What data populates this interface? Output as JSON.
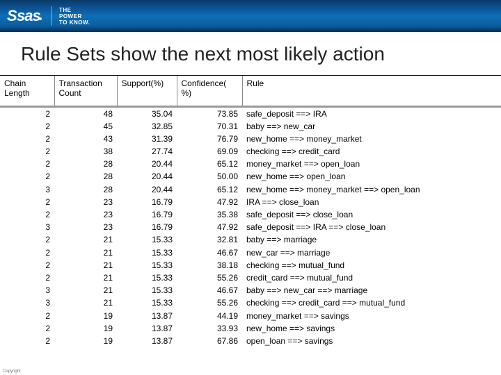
{
  "banner": {
    "brand": "SAS",
    "tagline_l1": "THE",
    "tagline_l2": "POWER",
    "tagline_l3": "TO KNOW."
  },
  "heading": "Rule Sets show the next most likely action",
  "table": {
    "columns": {
      "chain": "Chain\nLength",
      "count": "Transaction\nCount",
      "support": "Support(%)",
      "confidence": "Confidence(\n%)",
      "rule": "Rule"
    },
    "rows": [
      {
        "chain": "2",
        "count": "48",
        "support": "35.04",
        "confidence": "73.85",
        "rule": "safe_deposit ==> IRA"
      },
      {
        "chain": "2",
        "count": "45",
        "support": "32.85",
        "confidence": "70.31",
        "rule": "baby ==> new_car"
      },
      {
        "chain": "2",
        "count": "43",
        "support": "31.39",
        "confidence": "76.79",
        "rule": "new_home ==> money_market"
      },
      {
        "chain": "2",
        "count": "38",
        "support": "27.74",
        "confidence": "69.09",
        "rule": "checking ==> credit_card"
      },
      {
        "chain": "2",
        "count": "28",
        "support": "20.44",
        "confidence": "65.12",
        "rule": "money_market ==> open_loan"
      },
      {
        "chain": "2",
        "count": "28",
        "support": "20.44",
        "confidence": "50.00",
        "rule": "new_home ==> open_loan"
      },
      {
        "chain": "3",
        "count": "28",
        "support": "20.44",
        "confidence": "65.12",
        "rule": "new_home ==> money_market ==> open_loan"
      },
      {
        "chain": "2",
        "count": "23",
        "support": "16.79",
        "confidence": "47.92",
        "rule": "IRA ==> close_loan"
      },
      {
        "chain": "2",
        "count": "23",
        "support": "16.79",
        "confidence": "35.38",
        "rule": "safe_deposit ==> close_loan"
      },
      {
        "chain": "3",
        "count": "23",
        "support": "16.79",
        "confidence": "47.92",
        "rule": "safe_deposit ==> IRA ==> close_loan"
      },
      {
        "chain": "2",
        "count": "21",
        "support": "15.33",
        "confidence": "32.81",
        "rule": "baby ==> marriage"
      },
      {
        "chain": "2",
        "count": "21",
        "support": "15.33",
        "confidence": "46.67",
        "rule": "new_car ==> marriage"
      },
      {
        "chain": "2",
        "count": "21",
        "support": "15.33",
        "confidence": "38.18",
        "rule": "checking ==> mutual_fund"
      },
      {
        "chain": "2",
        "count": "21",
        "support": "15.33",
        "confidence": "55.26",
        "rule": "credit_card ==> mutual_fund"
      },
      {
        "chain": "3",
        "count": "21",
        "support": "15.33",
        "confidence": "46.67",
        "rule": "baby ==> new_car ==> marriage"
      },
      {
        "chain": "3",
        "count": "21",
        "support": "15.33",
        "confidence": "55.26",
        "rule": "checking ==> credit_card ==> mutual_fund"
      },
      {
        "chain": "2",
        "count": "19",
        "support": "13.87",
        "confidence": "44.19",
        "rule": "money_market ==> savings"
      },
      {
        "chain": "2",
        "count": "19",
        "support": "13.87",
        "confidence": "33.93",
        "rule": "new_home ==> savings"
      },
      {
        "chain": "2",
        "count": "19",
        "support": "13.87",
        "confidence": "67.86",
        "rule": "open_loan ==> savings"
      }
    ]
  },
  "copyright": "Copyright"
}
